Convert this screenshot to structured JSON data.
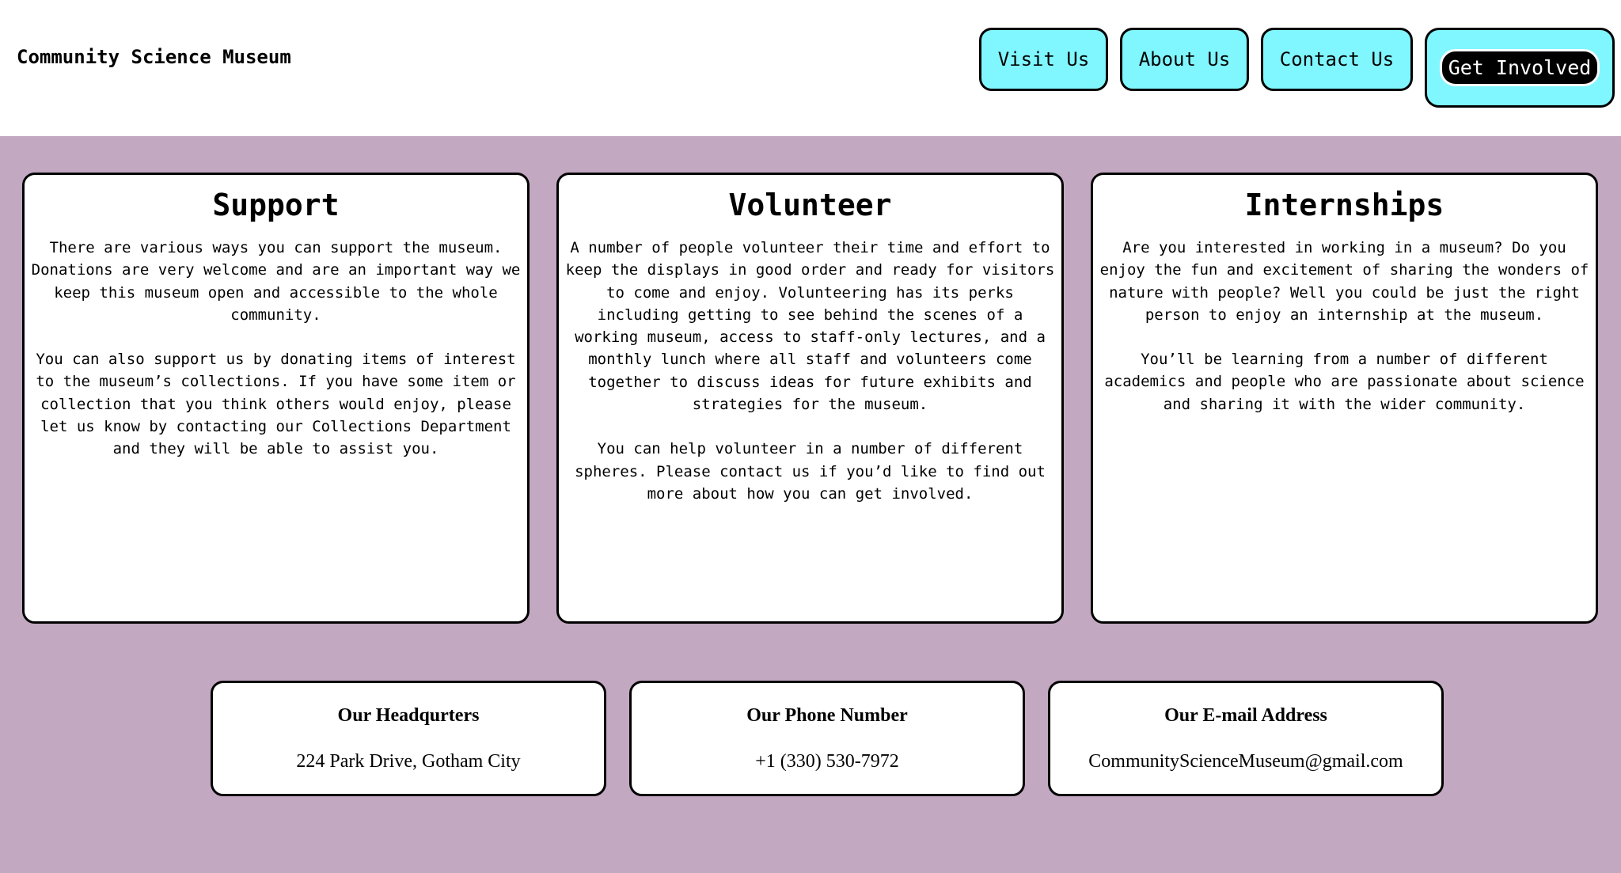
{
  "header": {
    "site_title": "Community Science Museum",
    "nav": [
      {
        "label": "Visit Us"
      },
      {
        "label": "About Us"
      },
      {
        "label": "Contact Us"
      },
      {
        "label": "Get Involved"
      }
    ]
  },
  "cards": [
    {
      "title": "Support",
      "paragraphs": [
        "There are various ways you can support the museum. Donations are very welcome and are an important way we keep this museum open and accessible to the whole community.",
        "You can also support us by donating items of interest to the museum’s collections. If you have some item or collection that you think others would enjoy, please let us know by contacting our Collections Department and they will be able to assist you."
      ]
    },
    {
      "title": "Volunteer",
      "paragraphs": [
        "A number of people volunteer their time and effort to keep the displays in good order and ready for visitors to come and enjoy. Volunteering has its perks including getting to see behind the scenes of a working museum, access to staff-only lectures, and a monthly lunch where all staff and volunteers come together to discuss ideas for future exhibits and strategies for the museum.",
        "You can help volunteer in a number of different spheres. Please contact us if you’d like to find out more about how you can get involved."
      ]
    },
    {
      "title": "Internships",
      "paragraphs": [
        "Are you interested in working in a museum? Do you enjoy the fun and excitement of sharing the wonders of nature with people? Well you could be just the right person to enjoy an internship at the museum.",
        "You’ll be learning from a number of different academics and people who are passionate about science and sharing it with the wider community."
      ]
    }
  ],
  "contact": [
    {
      "title": "Our Headqurters",
      "value": "224 Park Drive, Gotham City"
    },
    {
      "title": "Our Phone Number",
      "value": "+1 (330) 530-7972"
    },
    {
      "title": "Our E-mail Address",
      "value": "CommunityScienceMuseum@gmail.com"
    }
  ],
  "colors": {
    "nav_button": "#80f6ff",
    "background": "#c3a8c1",
    "cta_inner": "#000000"
  }
}
